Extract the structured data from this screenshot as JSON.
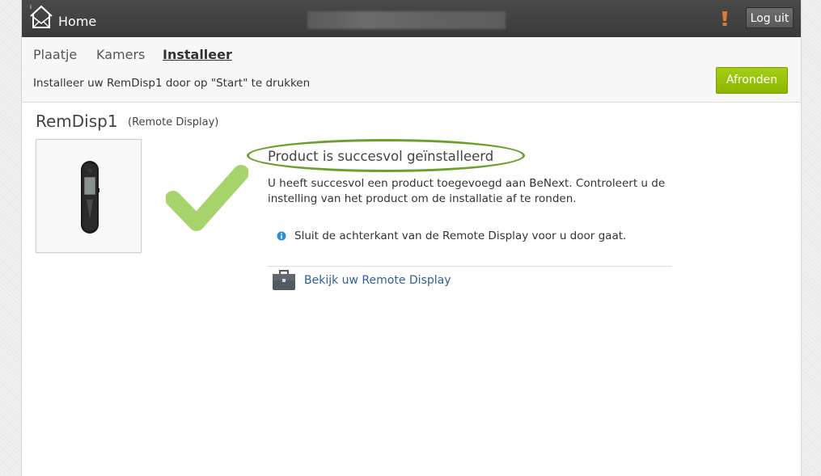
{
  "header": {
    "home_label": "Home",
    "logout_label": "Log uit",
    "alert_color": "#e07a3a"
  },
  "tabs": [
    {
      "label": "Plaatje",
      "active": false
    },
    {
      "label": "Kamers",
      "active": false
    },
    {
      "label": "Installeer",
      "active": true
    }
  ],
  "subheader": {
    "instruction": "Installeer uw RemDisp1 door op \"Start\" te drukken",
    "finish_label": "Afronden"
  },
  "product": {
    "name": "RemDisp1",
    "type": "(Remote Display)"
  },
  "result": {
    "title": "Product is succesvol geïnstalleerd",
    "message": "U heeft succesvol een product toegevoegd aan BeNext. Controleert u de instelling van het product om de installatie af te ronden.",
    "info": "Sluit de achterkant van de Remote Display voor u door gaat.",
    "link": "Bekijk uw Remote Display"
  },
  "icons": {
    "logo": "house-envelope-icon",
    "alert": "exclamation-icon",
    "check": "checkmark-icon",
    "info": "info-icon",
    "link": "briefcase-icon"
  },
  "colors": {
    "topbar": "#3f3f3f",
    "accent_green": "#96c00a",
    "check_green": "#a6d36a",
    "oval_green": "#6ba12a",
    "link_blue": "#2e5f9c"
  }
}
